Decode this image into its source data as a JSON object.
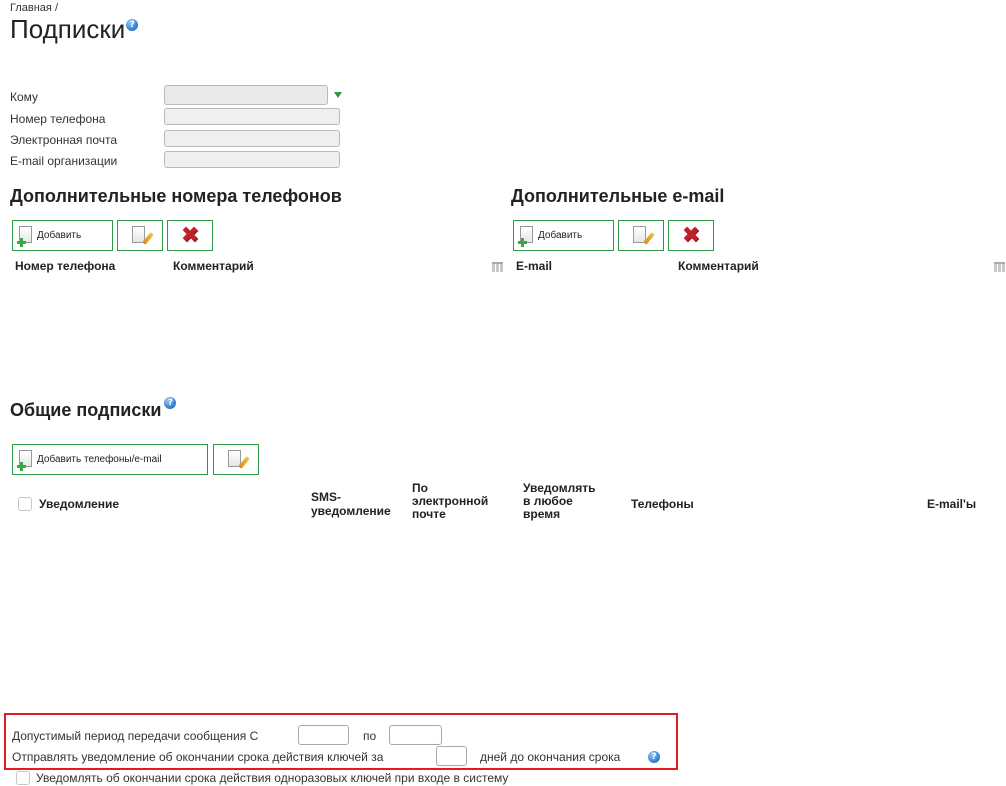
{
  "breadcrumb": {
    "home": "Главная",
    "separator": "/"
  },
  "page": {
    "title": "Подписки"
  },
  "form": {
    "fields": [
      {
        "label": "Кому",
        "value": ""
      },
      {
        "label": "Номер телефона",
        "value": ""
      },
      {
        "label": "Электронная почта",
        "value": ""
      },
      {
        "label": "E-mail организации",
        "value": ""
      }
    ]
  },
  "phones": {
    "title": "Дополнительные номера телефонов",
    "add_label": "Добавить",
    "columns": [
      "Номер телефона",
      "Комментарий"
    ]
  },
  "emails": {
    "title": "Дополнительные e-mail",
    "add_label": "Добавить",
    "columns": [
      "E-mail",
      "Комментарий"
    ]
  },
  "general": {
    "title": "Общие подписки",
    "add_label": "Добавить телефоны/e-mail",
    "columns": {
      "notification": "Уведомление",
      "sms_line1": "SMS-",
      "sms_line2": "уведомление",
      "email_line1": "По",
      "email_line2": "электронной",
      "email_line3": "почте",
      "anytime_line1": "Уведомлять",
      "anytime_line2": "в любое",
      "anytime_line3": "время",
      "phones": "Телефоны",
      "emails": "E-mail'ы"
    }
  },
  "settings": {
    "period_label": "Допустимый период передачи сообщения С",
    "period_to": "по",
    "period_from_value": "",
    "period_to_value": "",
    "expiry_prefix": "Отправлять уведомление об окончании срока действия ключей за",
    "expiry_days_value": "",
    "expiry_suffix": "дней до окончания срока",
    "onetime_label": "Уведомлять об окончании срока действия одноразовых ключей при входе в систему"
  },
  "colors": {
    "accent_green": "#2e9a47",
    "highlight_red": "#e01b23",
    "help_blue": "#2f7fd0"
  },
  "icons": [
    "help-icon",
    "add-document-icon",
    "edit-document-icon",
    "delete-icon",
    "column-toggle-icon",
    "dropdown-arrow-icon"
  ]
}
